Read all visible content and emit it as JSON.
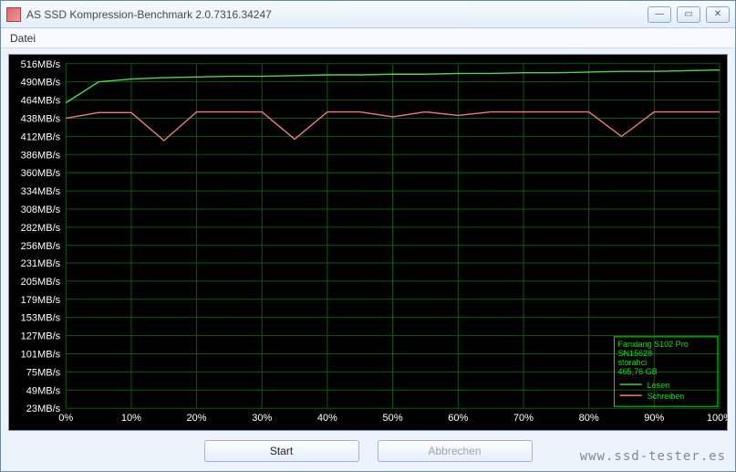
{
  "window": {
    "title": "AS SSD Kompression-Benchmark 2.0.7316.34247"
  },
  "menu": {
    "file": "Datei"
  },
  "chart_data": {
    "type": "line",
    "x_percent": [
      0,
      5,
      10,
      15,
      20,
      25,
      30,
      35,
      40,
      45,
      50,
      55,
      60,
      65,
      70,
      75,
      80,
      85,
      90,
      95,
      100
    ],
    "series": [
      {
        "name": "Lesen",
        "color": "#4bd94b",
        "values": [
          460,
          490,
          494,
          496,
          497,
          498,
          498,
          499,
          500,
          500,
          501,
          501,
          502,
          502,
          503,
          503,
          504,
          505,
          505,
          506,
          507
        ]
      },
      {
        "name": "Schreiben",
        "color": "#f07a7a",
        "values": [
          438,
          446,
          446,
          406,
          447,
          447,
          447,
          408,
          447,
          447,
          440,
          447,
          442,
          447,
          447,
          447,
          447,
          412,
          447,
          447,
          447
        ]
      }
    ],
    "title": "",
    "xlabel": "",
    "ylabel": "",
    "ylim": [
      23,
      516
    ],
    "y_ticks": [
      516,
      490,
      464,
      438,
      412,
      386,
      360,
      334,
      308,
      282,
      256,
      231,
      205,
      179,
      153,
      127,
      101,
      75,
      49,
      23
    ],
    "y_tick_suffix": "MB/s",
    "x_ticks": [
      0,
      10,
      20,
      30,
      40,
      50,
      60,
      70,
      80,
      90,
      100
    ],
    "x_tick_suffix": "%"
  },
  "device": {
    "model": "Fanxiang S102 Pro",
    "serial": "SN15628",
    "driver": "storahci",
    "capacity": "465,76 GB"
  },
  "legend": {
    "read": "Lesen",
    "write": "Schreiben"
  },
  "buttons": {
    "start": "Start",
    "abort": "Abbrechen"
  },
  "watermark": "www.ssd-tester.es"
}
